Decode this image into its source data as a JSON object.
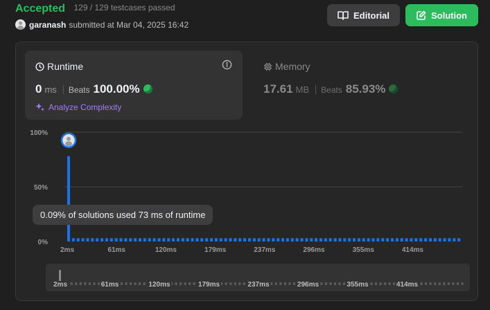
{
  "submission": {
    "status": "Accepted",
    "testcases": "129 / 129 testcases passed",
    "username": "garanash",
    "submitted_at": "submitted at Mar 04, 2025 16:42"
  },
  "actions": {
    "editorial_label": "Editorial",
    "solution_label": "Solution"
  },
  "runtime": {
    "title": "Runtime",
    "value": "0",
    "unit": "ms",
    "beats_label": "Beats",
    "beats_value": "100.00%",
    "analyze_label": "Analyze Complexity"
  },
  "memory": {
    "title": "Memory",
    "value": "17.61",
    "unit": "MB",
    "beats_label": "Beats",
    "beats_value": "85.93%"
  },
  "tooltip": "0.09% of solutions used 73 ms of runtime",
  "colors": {
    "accent_green": "#2cbb5d",
    "bar_blue": "#1a73e8",
    "purple": "#a47cf5"
  },
  "chart_data": {
    "type": "bar",
    "y_ticks": [
      "100%",
      "50%",
      "0%"
    ],
    "ylim": [
      0,
      100
    ],
    "x_ticks": [
      "2ms",
      "61ms",
      "120ms",
      "179ms",
      "237ms",
      "296ms",
      "355ms",
      "414ms"
    ],
    "values": [
      78,
      3,
      3,
      3,
      3,
      3,
      3,
      3,
      3,
      3,
      3,
      3,
      3,
      3,
      3,
      3,
      3,
      3,
      3,
      3,
      3,
      3,
      3,
      3,
      3,
      3,
      3,
      3,
      3,
      3,
      3,
      3,
      3,
      3,
      3,
      3,
      3,
      3,
      3,
      3,
      3,
      3,
      3,
      3,
      3,
      3,
      3,
      3,
      3,
      3,
      3,
      3,
      3,
      3,
      3,
      3,
      3,
      3,
      3,
      3,
      3,
      3,
      3,
      3,
      3,
      3,
      3,
      3,
      3,
      3,
      3,
      3,
      3,
      3,
      3,
      3,
      3,
      3,
      3,
      3,
      3,
      3,
      3
    ],
    "highlight_index": 0,
    "grid": true
  },
  "scrollbar_ticks": [
    "2ms",
    "61ms",
    "120ms",
    "179ms",
    "237ms",
    "296ms",
    "355ms",
    "414ms"
  ]
}
